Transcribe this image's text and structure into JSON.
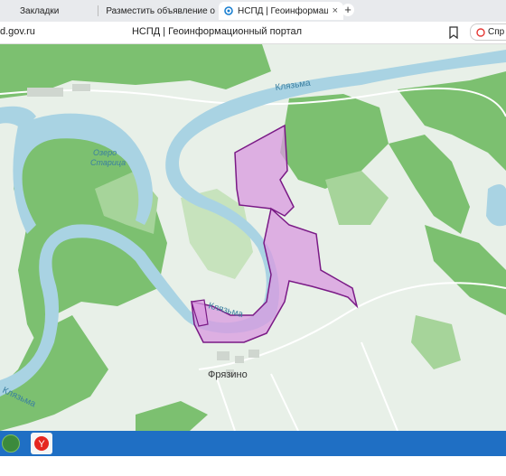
{
  "browser": {
    "tabs": [
      {
        "label": "Закладки",
        "icon": "bookmarks-icon"
      },
      {
        "label": "Разместить объявление о",
        "icon": "avito-logo-icon"
      },
      {
        "label": "НСПД | Геоинформационный портал",
        "icon": "nspd-logo-icon",
        "active": true
      }
    ],
    "new_tab": "+",
    "close": "×",
    "url": "d.gov.ru",
    "page_title": "НСПД | Геоинформационный портал",
    "help_button": "Спр"
  },
  "map": {
    "labels": {
      "river_top": "Клязьма",
      "river_mid": "Клязьма",
      "river_bottom": "Клязьма",
      "lake_line1": "Озеро",
      "lake_line2": "Старица",
      "village": "Фрязино"
    },
    "colors": {
      "water": "#a9d3e3",
      "forest": "#7cc070",
      "land": "#e6efe6",
      "parcel_fill": "#d99ae0",
      "parcel_stroke": "#7a1a86"
    }
  },
  "taskbar": {
    "items": [
      "start-button",
      "yandex-browser-icon"
    ],
    "yandex_glyph": "Y"
  }
}
